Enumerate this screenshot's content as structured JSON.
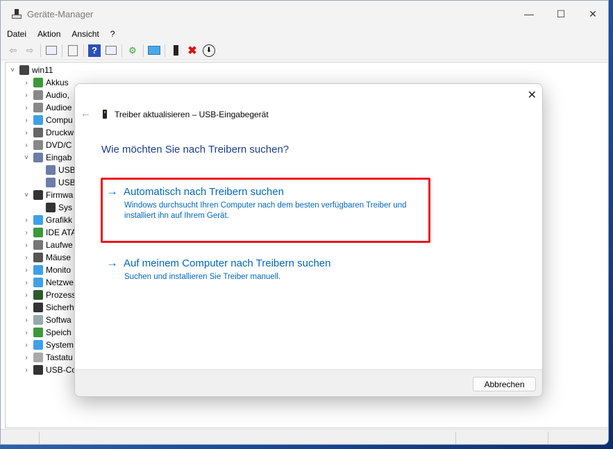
{
  "window": {
    "title": "Geräte-Manager",
    "minimize": "—",
    "maximize": "☐",
    "close": "✕"
  },
  "menu": [
    "Datei",
    "Aktion",
    "Ansicht",
    "?"
  ],
  "tree": {
    "root": "win11",
    "items": [
      {
        "label": "Akkus",
        "expanded": false,
        "color": "#3a9a3a"
      },
      {
        "label": "Audio,",
        "expanded": false,
        "color": "#888"
      },
      {
        "label": "Audioe",
        "expanded": false,
        "color": "#888"
      },
      {
        "label": "Compu",
        "expanded": false,
        "color": "#3fa0e8"
      },
      {
        "label": "Druckw",
        "expanded": false,
        "color": "#666"
      },
      {
        "label": "DVD/C",
        "expanded": false,
        "color": "#888"
      },
      {
        "label": "Eingab",
        "expanded": true,
        "color": "#6a7ea8",
        "children": [
          "USB",
          "USB"
        ]
      },
      {
        "label": "Firmwa",
        "expanded": true,
        "color": "#333",
        "children": [
          "Sys"
        ]
      },
      {
        "label": "Grafikk",
        "expanded": false,
        "color": "#3fa0e8"
      },
      {
        "label": "IDE ATA",
        "expanded": false,
        "color": "#3a9a3a"
      },
      {
        "label": "Laufwe",
        "expanded": false,
        "color": "#777"
      },
      {
        "label": "Mäuse",
        "expanded": false,
        "color": "#555"
      },
      {
        "label": "Monito",
        "expanded": false,
        "color": "#3fa0e8"
      },
      {
        "label": "Netzwe",
        "expanded": false,
        "color": "#3fa0e8"
      },
      {
        "label": "Prozess",
        "expanded": false,
        "color": "#2d5a2d"
      },
      {
        "label": "Sicherh",
        "expanded": false,
        "color": "#333"
      },
      {
        "label": "Softwa",
        "expanded": false,
        "color": "#9aa"
      },
      {
        "label": "Speich",
        "expanded": false,
        "color": "#3a9a3a"
      },
      {
        "label": "System",
        "expanded": false,
        "color": "#3fa0e8"
      },
      {
        "label": "Tastatu",
        "expanded": false,
        "color": "#aaa"
      },
      {
        "label": "USB-Co",
        "expanded": false,
        "color": "#333"
      }
    ]
  },
  "dialog": {
    "close": "✕",
    "back": "←",
    "title": "Treiber aktualisieren – USB-Eingabegerät",
    "heading": "Wie möchten Sie nach Treibern suchen?",
    "arrow": "→",
    "options": [
      {
        "title": "Automatisch nach Treibern suchen",
        "desc": "Windows durchsucht Ihren Computer nach dem besten verfügbaren Treiber und installiert ihn auf Ihrem Gerät."
      },
      {
        "title": "Auf meinem Computer nach Treibern suchen",
        "desc": "Suchen und installieren Sie Treiber manuell."
      }
    ],
    "cancel": "Abbrechen"
  },
  "colors": {
    "link": "#0067c0",
    "highlight": "#f0141e",
    "heading": "#1a3d8f"
  }
}
